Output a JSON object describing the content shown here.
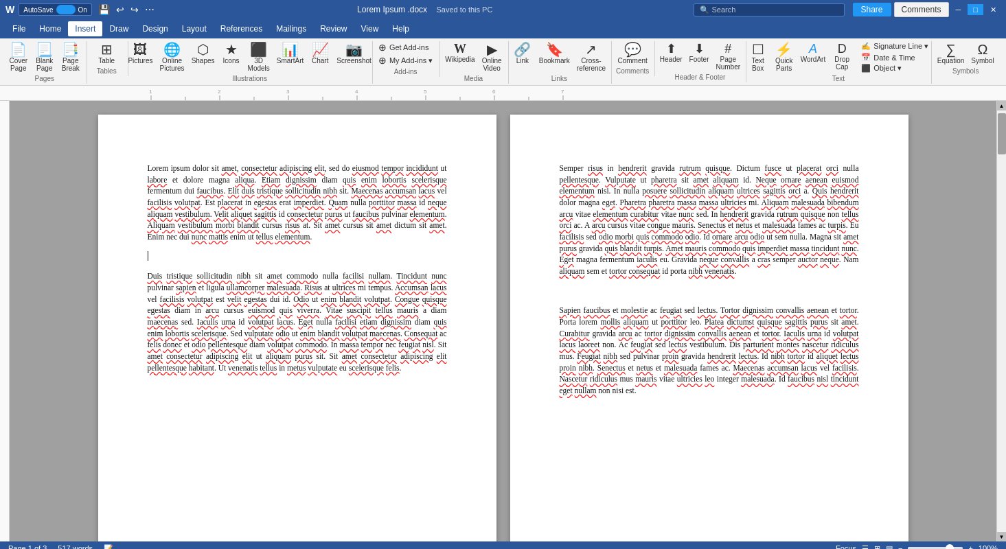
{
  "titlebar": {
    "autosave_label": "AutoSave",
    "autosave_on": "On",
    "filename": "Lorem Ipsum .docx",
    "saved_label": "Saved to this PC",
    "search_placeholder": "Search",
    "share_label": "Share",
    "comments_label": "Comments",
    "minimize_label": "─",
    "maximize_label": "□",
    "close_label": "✕"
  },
  "menu": {
    "items": [
      {
        "label": "File",
        "active": false
      },
      {
        "label": "Home",
        "active": false
      },
      {
        "label": "Insert",
        "active": true
      },
      {
        "label": "Draw",
        "active": false
      },
      {
        "label": "Design",
        "active": false
      },
      {
        "label": "Layout",
        "active": false
      },
      {
        "label": "References",
        "active": false
      },
      {
        "label": "Mailings",
        "active": false
      },
      {
        "label": "Review",
        "active": false
      },
      {
        "label": "View",
        "active": false
      },
      {
        "label": "Help",
        "active": false
      }
    ]
  },
  "ribbon": {
    "groups": [
      {
        "label": "Pages",
        "buttons": [
          {
            "label": "Cover\nPage",
            "icon": "📄"
          },
          {
            "label": "Blank\nPage",
            "icon": "📃"
          },
          {
            "label": "Page\nBreak",
            "icon": "📑"
          }
        ]
      },
      {
        "label": "Tables",
        "buttons": [
          {
            "label": "Table",
            "icon": "⊞"
          }
        ]
      },
      {
        "label": "Illustrations",
        "buttons": [
          {
            "label": "Pictures",
            "icon": "🖼"
          },
          {
            "label": "Online\nPictures",
            "icon": "🌐"
          },
          {
            "label": "Shapes",
            "icon": "⬡"
          },
          {
            "label": "Icons",
            "icon": "★"
          },
          {
            "label": "3D\nModels",
            "icon": "⬛"
          },
          {
            "label": "SmartArt",
            "icon": "📊"
          },
          {
            "label": "Chart",
            "icon": "📈"
          },
          {
            "label": "Screenshot",
            "icon": "📷"
          }
        ]
      },
      {
        "label": "Add-ins",
        "stack_items": [
          {
            "label": "Get Add-ins",
            "icon": "⊕"
          },
          {
            "label": "My Add-ins",
            "icon": "⊕"
          }
        ]
      },
      {
        "label": "Media",
        "buttons": [
          {
            "label": "Wikipedia",
            "icon": "W"
          },
          {
            "label": "Online\nVideo",
            "icon": "▶"
          }
        ]
      },
      {
        "label": "Links",
        "buttons": [
          {
            "label": "Link",
            "icon": "🔗"
          },
          {
            "label": "Bookmark",
            "icon": "🔖"
          },
          {
            "label": "Cross-\nreference",
            "icon": "↗"
          }
        ]
      },
      {
        "label": "Comments",
        "buttons": [
          {
            "label": "Comment",
            "icon": "💬"
          }
        ]
      },
      {
        "label": "Header & Footer",
        "buttons": [
          {
            "label": "Header",
            "icon": "⬆"
          },
          {
            "label": "Footer",
            "icon": "⬇"
          },
          {
            "label": "Page\nNumber",
            "icon": "#"
          }
        ]
      },
      {
        "label": "Text",
        "buttons": [
          {
            "label": "Text\nBox",
            "icon": "☐"
          },
          {
            "label": "Quick\nParts",
            "icon": "⚡"
          },
          {
            "label": "WordArt",
            "icon": "A"
          },
          {
            "label": "Drop\nCap",
            "icon": "D"
          }
        ],
        "stack_items": [
          {
            "label": "Signature Line",
            "icon": "✍"
          },
          {
            "label": "Date & Time",
            "icon": "📅"
          },
          {
            "label": "Object",
            "icon": "⬛"
          }
        ]
      },
      {
        "label": "Symbols",
        "buttons": [
          {
            "label": "Equation",
            "icon": "∑"
          },
          {
            "label": "Symbol",
            "icon": "Ω"
          }
        ]
      }
    ]
  },
  "doc": {
    "page1": {
      "paragraphs": [
        "Lorem ipsum dolor sit amet, consectetur adipiscing elit, sed do eiusmod tempor incididunt ut labore et dolore magna aliqua. Etiam dignissim diam quis enim lobortis scelerisque fermentum dui faucibus. Elit duis tristique sollicitudin nibh sit. Maecenas accumsan lacus vel facilisis volutpat. Est placerat in egestas erat imperdiet. Quam nulla porttitor massa id neque aliquam vestibulum. Velit aliquet sagittis id consectetur purus ut faucibus pulvinar elementum. Aliquam vestibulum morbi blandit cursus risus at. Sit amet cursus sit amet dictum sit amet. Enim nec dui nunc mattis enim ut tellus elementum.",
        "",
        "Duis tristique sollicitudin nibh sit amet commodo nulla facilisi nullam. Tincidunt nunc pulvinar sapien et ligula ullamcorper malesuada. Risus at ultrices mi tempus. Accumsan lacus vel facilisis volutpat est velit egestas dui id. Odio ut enim blandit volutpat. Congue quisque egestas diam in arcu cursus euismod quis viverra. Vitae suscipit tellus mauris a diam maecenas sed. Iaculis urna id volutpat lacus. Eget nulla facilisi etiam dignissim diam quis enim lobortis scelerisque. Sed vulputate odio ut enim blandit volutpat maecenas. Consequat ac felis donec et odio pellentesque diam volutpat commodo. In massa tempor nec feugiat nisl. Sit amet consectetur adipiscing elit ut aliquam purus sit. Sit amet consectetur adipiscing elit pellentesque habitant. Ut venenatis tellus in metus vulputate eu scelerisque felis."
      ]
    },
    "page2": {
      "paragraphs": [
        "Semper risus in hendrerit gravida rutrum quisque. Dictum fusce ut placerat orci nulla pellentesque. Vulputate ut pharetra sit amet aliquam id. Neque ornare aenean euismod elementum nisi. In nulla posuere sollicitudin aliquam ultrices sagittis orci a. Quis hendrerit dolor magna eget. Pharetra pharetra massa massa ultricies mi. Aliquam malesuada bibendum arcu vitae elementum curabitur vitae nunc sed. In hendrerit gravida rutrum quisque non tellus orci ac. A arcu cursus vitae congue mauris. Senectus et netus et malesuada fames ac turpis. Eu facilisis sed odio morbi quis commodo odio. Id ornare arcu odio ut sem nulla. Magna sit amet purus gravida quis blandit turpis. Amet mauris commodo quis imperdiet massa tincidunt nunc. Eget magna fermentum iaculis eu. Gravida neque convallis a cras semper auctor neque. Nam aliquam sem et tortor consequat id porta nibh venenatis.",
        "",
        "Sapien faucibus et molestie ac feugiat sed lectus. Tortor dignissim convallis aenean et tortor. Porta lorem mollis aliquam ut porttitor leo. Platea dictumst quisque sagittis purus sit amet. Curabitur gravida arcu ac tortor dignissim convallis aenean et tortor. Iaculis urna id volutpat lacus laoreet non. Ac feugiat sed lectus vestibulum. Dis parturient montes nascetur ridiculus mus. Feugiat nibh sed pulvinar proin gravida hendrerit lectus. Id nibh tortor id aliquet lectus proin nibh. Senectus et netus et malesuada fames ac. Maecenas accumsan lacus vel facilisis. Nascetur ridiculus mus mauris vitae ultricies leo integer malesuada. Id faucibus nisl tincidunt eget nullam non nisi est."
      ]
    }
  },
  "statusbar": {
    "page_info": "Page 1 of 3",
    "word_count": "517 words",
    "language_icon": "📝",
    "focus_label": "Focus",
    "view_icons": [
      "☰",
      "⊞",
      "▤"
    ],
    "zoom_minus": "−",
    "zoom_bar": "▬",
    "zoom_plus": "+",
    "zoom_level": "100%"
  },
  "underlined_words_p1": [
    "amet",
    "consectetur",
    "adipiscing",
    "elit",
    "eiusmod",
    "tempor",
    "incididunt",
    "labore",
    "Etiam",
    "dignissim",
    "quis",
    "enim",
    "lobortis",
    "scelerisque",
    "faucibus",
    "Elit",
    "duis",
    "tristique",
    "sollicitudin",
    "nibh",
    "accumsan",
    "lacus",
    "facilisis",
    "volutpat",
    "placerat",
    "egestas",
    "porttitor",
    "neque",
    "aliquam",
    "sagittis",
    "consectetur",
    "purus",
    "faucibus",
    "elementum",
    "Aliquam",
    "morbi",
    "blandit",
    "risus",
    "amet",
    "amet",
    "amet",
    "nunc",
    "mattis",
    "tellus"
  ],
  "colors": {
    "accent_blue": "#2b579a",
    "ribbon_bg": "#f3f3f3",
    "page_bg": "white",
    "statusbar_bg": "#2b579a"
  }
}
